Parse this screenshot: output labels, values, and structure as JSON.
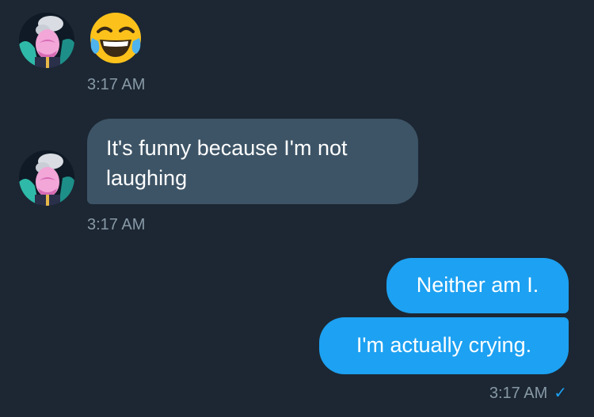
{
  "conversation": {
    "messages": [
      {
        "emoji": "face-with-tears-of-joy",
        "timestamp": "3:17 AM"
      },
      {
        "text": "It's funny because I'm not laughing",
        "timestamp": "3:17 AM"
      },
      {
        "text": "Neither am I."
      },
      {
        "text": "I'm actually crying.",
        "timestamp": "3:17 AM",
        "read_receipt": "✓"
      }
    ]
  },
  "colors": {
    "background": "#1c2733",
    "incoming_bubble": "#3d5466",
    "outgoing_bubble": "#1da1f2",
    "timestamp": "#8899a6"
  }
}
